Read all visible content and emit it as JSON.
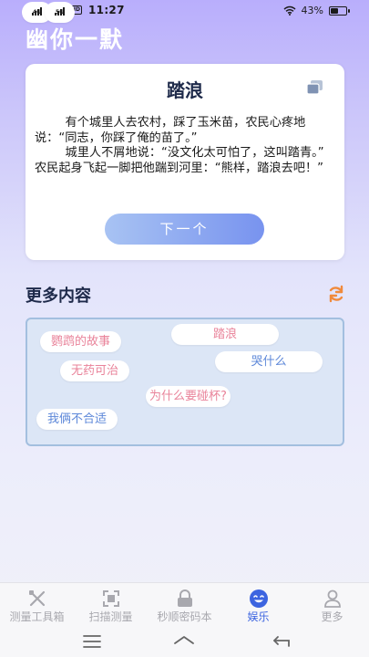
{
  "status_bar": {
    "sim1": "4G",
    "sim2": "5G",
    "hd": "HD",
    "time": "11:27",
    "battery": "43%",
    "battery_level": 0.43
  },
  "app_title": "幽你一默",
  "joke": {
    "title": "踏浪",
    "body": "        有个城里人去农村，踩了玉米苗，农民心疼地说：“同志，你踩了俺的苗了。”\n        城里人不屑地说：“没文化太可怕了，这叫踏青。”        农民起身飞起一脚把他踹到河里：“熊样，踏浪去吧！”",
    "next_label": "下一个",
    "copy_icon": "copy-icon"
  },
  "more": {
    "title": "更多内容",
    "refresh_icon": "refresh-icon",
    "tags": [
      {
        "label": "鹦鹉的故事",
        "color": "#e9839a"
      },
      {
        "label": "踏浪",
        "color": "#e9839a"
      },
      {
        "label": "哭什么",
        "color": "#5e88d9"
      },
      {
        "label": "无药可治",
        "color": "#e9839a"
      },
      {
        "label": "为什么要碰杯?",
        "color": "#e9839a"
      },
      {
        "label": "我俩不合适",
        "color": "#5e88d9"
      }
    ]
  },
  "tabs": [
    {
      "label": "测量工具箱",
      "icon": "tools-icon",
      "active": false
    },
    {
      "label": "扫描测量",
      "icon": "scan-icon",
      "active": false
    },
    {
      "label": "秒顺密码本",
      "icon": "lock-icon",
      "active": false
    },
    {
      "label": "娱乐",
      "icon": "smiley-icon",
      "active": true
    },
    {
      "label": "更多",
      "icon": "person-icon",
      "active": false
    }
  ],
  "colors": {
    "accent": "#3c64e0",
    "tag_pink": "#e9839a",
    "tag_blue": "#5e88d9",
    "refresh": "#f08a3c"
  }
}
